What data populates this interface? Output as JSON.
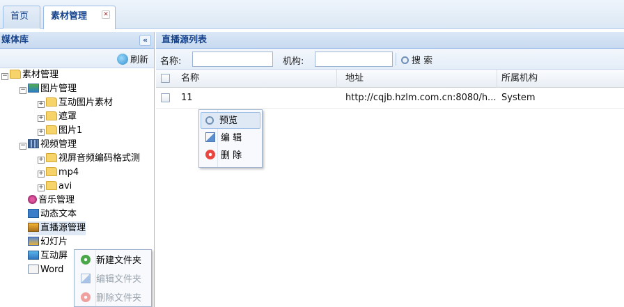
{
  "tabs": [
    {
      "label": "首页"
    },
    {
      "label": "素材管理"
    }
  ],
  "left_panel": {
    "title": "媒体库",
    "collapse_glyph": "«",
    "refresh_label": "刷新",
    "tree": [
      {
        "label": "素材管理",
        "icon": "folder-icon"
      },
      {
        "label": "图片管理",
        "icon": "image-icon"
      },
      {
        "label": "互动图片素材",
        "icon": "folder-icon"
      },
      {
        "label": "遮罩",
        "icon": "folder-icon"
      },
      {
        "label": "图片1",
        "icon": "folder-icon"
      },
      {
        "label": "视频管理",
        "icon": "video-icon"
      },
      {
        "label": "视屏音频编码格式测",
        "icon": "folder-icon"
      },
      {
        "label": "mp4",
        "icon": "folder-icon"
      },
      {
        "label": "avi",
        "icon": "folder-icon"
      },
      {
        "label": "音乐管理",
        "icon": "music-icon"
      },
      {
        "label": "动态文本",
        "icon": "text-icon"
      },
      {
        "label": "直播源管理",
        "icon": "live-icon"
      },
      {
        "label": "幻灯片",
        "icon": "slide-icon"
      },
      {
        "label": "互动屏",
        "icon": "interactive-icon"
      },
      {
        "label": "Word",
        "icon": "word-icon"
      }
    ],
    "context_menu": [
      {
        "label": "新建文件夹",
        "icon": "add-icon",
        "enabled": true
      },
      {
        "label": "编辑文件夹",
        "icon": "edit-icon",
        "enabled": false
      },
      {
        "label": "删除文件夹",
        "icon": "delete-icon",
        "enabled": false
      }
    ]
  },
  "right_panel": {
    "title": "直播源列表",
    "search": {
      "name_label": "名称:",
      "name_value": "",
      "org_label": "机构:",
      "org_value": "",
      "search_label": "搜 索"
    },
    "columns": [
      "名称",
      "地址",
      "所属机构"
    ],
    "rows": [
      {
        "name": "11",
        "address": "http://cqjb.hzlm.com.cn:8080/h...",
        "org": "System"
      }
    ],
    "context_menu": [
      {
        "label": "预览",
        "icon": "preview-icon",
        "highlighted": true
      },
      {
        "label": "编 辑",
        "icon": "edit-icon"
      },
      {
        "label": "删 除",
        "icon": "delete-icon"
      }
    ]
  },
  "colors": {
    "header_text": "#15428b",
    "border": "#99bbe8"
  }
}
